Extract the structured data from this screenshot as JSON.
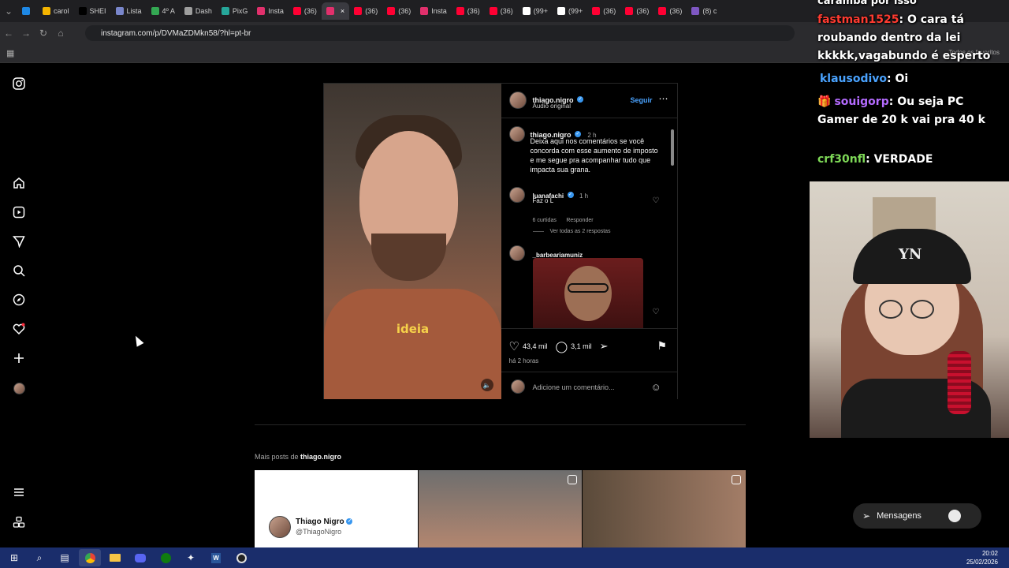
{
  "browser": {
    "tabs": [
      {
        "label": "",
        "color": "#1e88e5"
      },
      {
        "label": "carol",
        "color": "#f4b400"
      },
      {
        "label": "SHEI",
        "color": "#000000"
      },
      {
        "label": "Lista",
        "color": "#7986cb"
      },
      {
        "label": "4º A",
        "color": "#34a853"
      },
      {
        "label": "Dash",
        "color": "#9e9e9e"
      },
      {
        "label": "PixG",
        "color": "#26a69a"
      },
      {
        "label": "Insta",
        "color": "#e1306c"
      },
      {
        "label": "(36)",
        "color": "#ff0033"
      },
      {
        "label": "",
        "color": "#e1306c",
        "active": true
      },
      {
        "label": "(36)",
        "color": "#ff0033"
      },
      {
        "label": "(36)",
        "color": "#ff0033"
      },
      {
        "label": "Insta",
        "color": "#e1306c"
      },
      {
        "label": "(36)",
        "color": "#ff0033"
      },
      {
        "label": "(36)",
        "color": "#ff0033"
      },
      {
        "label": "(99+",
        "color": "#ffffff"
      },
      {
        "label": "(99+",
        "color": "#ffffff"
      },
      {
        "label": "(36)",
        "color": "#ff0033"
      },
      {
        "label": "(36)",
        "color": "#ff0033"
      },
      {
        "label": "(36)",
        "color": "#ff0033"
      },
      {
        "label": "(8) c",
        "color": "#7e57c2"
      }
    ],
    "url": "instagram.com/p/DVMaZDMkn58/?hl=pt-br",
    "bookmarks_label": "Todos os favoritos"
  },
  "post": {
    "author": "thiago.nigro",
    "audio": "Áudio original",
    "follow_label": "Seguir",
    "video_caption": "ideia",
    "caption_author": "thiago.nigro",
    "caption_time": "2 h",
    "caption_text": "Deixa aqui nos comentários se você concorda com esse aumento de imposto e me segue pra acompanhar tudo que impacta sua grana.",
    "comments": [
      {
        "user": "luanafachi",
        "time": "1 h",
        "text": "Faz o L",
        "likes": "6 curtidas",
        "reply_label": "Responder",
        "view_replies": "Ver todas as 2 respostas"
      },
      {
        "user": "_barbeariamuniz",
        "time": "",
        "text": ""
      }
    ],
    "likes": "43,4 mil",
    "comment_count": "3,1 mil",
    "posted": "há 2 horas",
    "add_comment_placeholder": "Adicione um comentário..."
  },
  "more_posts": {
    "prefix": "Mais posts de",
    "author": "thiago.nigro",
    "card_name": "Thiago Nigro",
    "card_handle": "@ThiagoNigro"
  },
  "messages_label": "Mensagens",
  "chat": [
    {
      "user": "fastman1525",
      "text": ": O cara tá roubando dentro da lei kkkkk,vagabundo é esperto",
      "color": "#ff3b30"
    },
    {
      "user": "klausodivo",
      "text": ": Oi",
      "color": "#4aa3ff"
    },
    {
      "user": "souigorp",
      "text": ": Ou seja PC Gamer de 20 k vai pra 40 k",
      "color": "#b46bff"
    },
    {
      "user": "crf30nfl",
      "text": ": VERDADE",
      "color": "#7ed957"
    }
  ],
  "chat_top_fragment": "caramba por isso",
  "clock": {
    "time": "20:02",
    "date": "25/02/2026"
  }
}
